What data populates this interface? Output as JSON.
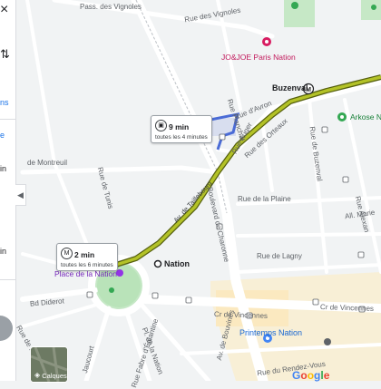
{
  "sidebar": {
    "close_icon": "×",
    "snippets": [
      "ns",
      "e",
      "in",
      "in"
    ]
  },
  "streets": {
    "pass_des_vignoles": "Pass. des Vignoles",
    "rue_des_vignoles": "Rue des Vignoles",
    "rue_planchat": "Rue Planchat",
    "rue_davron": "Rue d'Avron",
    "rue_auger": "Rue Auger",
    "rue_des_orteaux": "Rue des Orteaux",
    "rue_de_buzenval": "Rue de Buzenval",
    "bd_de_charonne": "Boulevard de Charonne",
    "av_de_taillebourg": "Av. de Taillebourg",
    "rue_de_montreuil": "de Montreuil",
    "rue_de_tunis": "Rue de Tunis",
    "rue_de_la_plaine": "Rue de la Plaine",
    "rue_de_lagny": "Rue de Lagny",
    "cr_de_vincennes_1": "Cr de Vincennes",
    "cr_de_vincennes_2": "Cr de Vincennes",
    "bd_diderot": "Bd Diderot",
    "rue_fabre": "Rue Fabre d'Églantine",
    "rue_jaucourt": "Jaucourt",
    "pl_de_la_nation": "Pl. de la Nation",
    "rue_du_rendez_vous": "Rue du Rendez-Vous",
    "all_marie": "All. Marie",
    "rue_de_bouvines": "Av. de Bouvines",
    "rue_de_picpus": "Rue de Picpus",
    "rue_alexandre": "Rue Alexan"
  },
  "pois": {
    "jo_joe": "JO&JOE Paris Nation",
    "arkose": "Arkose Nation",
    "printemps": "Printemps Nation",
    "place_nation": "Place de la Nation"
  },
  "metro": {
    "buzenval": "Buzenval",
    "nation": "Nation",
    "metro_glyph": "M"
  },
  "transit_bubbles": [
    {
      "time": "9 min",
      "frequency": "toutes les 4 minutes",
      "mode_icon": "bus-icon"
    },
    {
      "time": "2 min",
      "frequency": "toutes les 6 minutes",
      "mode_icon": "metro-icon"
    }
  ],
  "controls": {
    "layers_label": "Calques",
    "collapse_icon": "◀"
  },
  "brand": {
    "google_letters": [
      "G",
      "o",
      "o",
      "g",
      "l",
      "e"
    ],
    "google_colors": [
      "#4285f4",
      "#ea4335",
      "#fbbc05",
      "#4285f4",
      "#34a853",
      "#ea4335"
    ]
  },
  "colors": {
    "route": "#8a9a1c",
    "route_outline": "#56600f",
    "bus_segment": "#4b6cd6",
    "park": "#c6e8c6",
    "poi_pink": "#c2185b",
    "poi_green": "#188038"
  }
}
